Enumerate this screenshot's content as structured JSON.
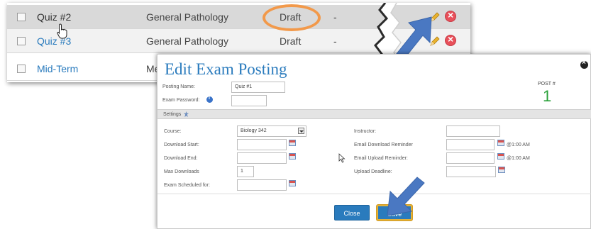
{
  "list": {
    "rows": [
      {
        "name": "Quiz #2",
        "course": "General Pathology",
        "status": "Draft",
        "dash": "-"
      },
      {
        "name": "Quiz #3",
        "course": "General Pathology",
        "status": "Draft",
        "dash": "-"
      },
      {
        "name": "Mid-Term",
        "course": "Me",
        "status": "",
        "dash": ""
      }
    ]
  },
  "modal": {
    "title": "Edit Exam Posting",
    "posting_name_label": "Posting Name:",
    "posting_name_value": "Quiz #1",
    "exam_password_label": "Exam Password:",
    "post_label": "POST #",
    "post_number": "1",
    "settings_label": "Settings",
    "course_label": "Course:",
    "course_value": "Biology 342",
    "download_start_label": "Download Start:",
    "download_end_label": "Download End:",
    "max_downloads_label": "Max Downloads",
    "max_downloads_value": "1",
    "exam_scheduled_label": "Exam Scheduled for:",
    "instructor_label": "Instructor:",
    "email_download_label": "Email Download Reminder",
    "email_upload_label": "Email Upload Reminder:",
    "upload_deadline_label": "Upload Deadline:",
    "time_1": "@1:00 AM",
    "time_2": "@1:00 AM",
    "close_label": "Close",
    "save_label": "Save"
  },
  "colors": {
    "accent": "#2a7bbd",
    "highlight": "#f2994a",
    "post_number": "#2aa13a",
    "arrow": "#4a78c2"
  },
  "icons": [
    "pencil-icon",
    "delete-icon",
    "info-icon",
    "calendar-icon",
    "settings-icon",
    "close-icon",
    "hand-cursor-icon",
    "arrow-cursor-icon"
  ]
}
